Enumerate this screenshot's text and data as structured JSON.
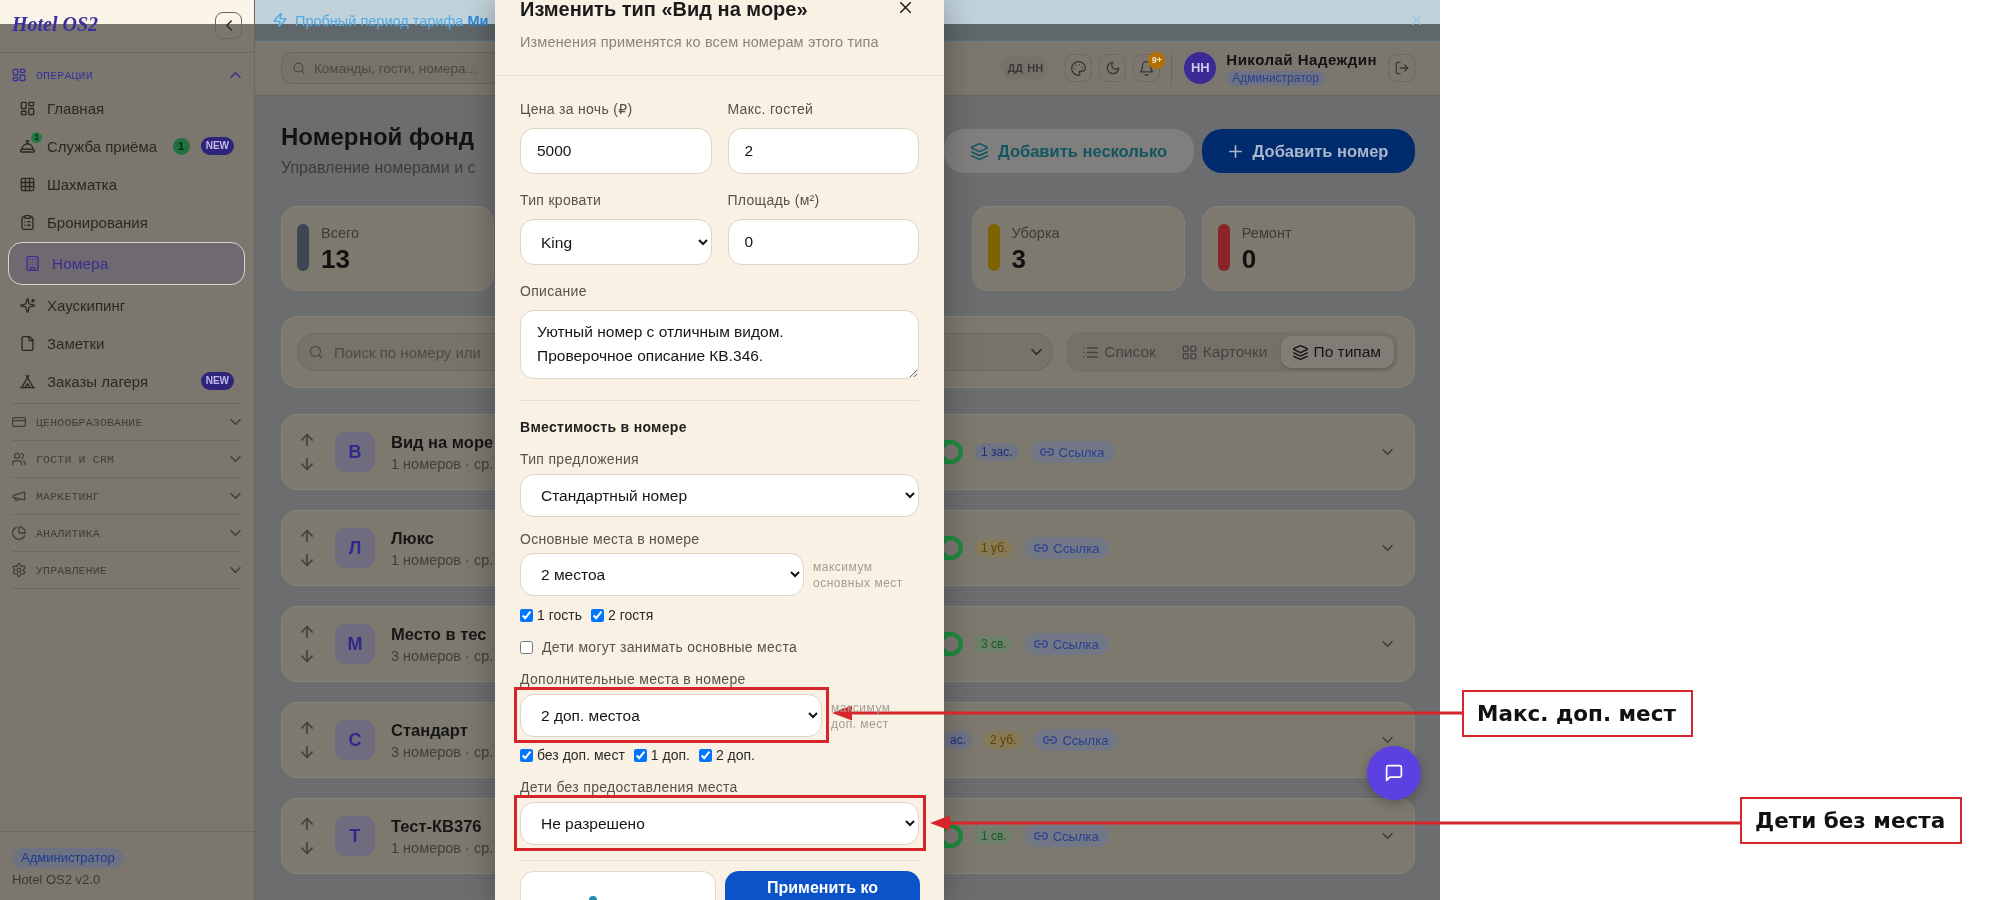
{
  "sidebar": {
    "logo": "Hotel OS2",
    "groups": [
      {
        "title": "ОПЕРАЦИИ",
        "expanded": true,
        "items": [
          {
            "label": "Главная",
            "selected": false
          },
          {
            "label": "Служба приёма",
            "selected": false,
            "icon_badge": "1",
            "count": "1",
            "tag": "NEW"
          },
          {
            "label": "Шахматка",
            "selected": false
          },
          {
            "label": "Бронирования",
            "selected": false
          },
          {
            "label": "Номера",
            "selected": true
          },
          {
            "label": "Хаускипинг",
            "selected": false
          },
          {
            "label": "Заметки",
            "selected": false
          },
          {
            "label": "Заказы лагеря",
            "selected": false,
            "tag": "NEW"
          }
        ]
      },
      {
        "title": "ЦЕНООБРАЗОВАНИЕ",
        "expanded": false
      },
      {
        "title": "ГОСТИ И CRM",
        "expanded": false
      },
      {
        "title": "МАРКЕТИНГ",
        "expanded": false
      },
      {
        "title": "АНАЛИТИКА",
        "expanded": false
      },
      {
        "title": "УПРАВЛЕНИЕ",
        "expanded": false
      }
    ],
    "role": "Администратор",
    "version": "Hotel OS2 v2.0"
  },
  "banner": {
    "text": "Пробный период тарифа **Ми**"
  },
  "topbar": {
    "search": {
      "placeholder": "Команды, гости, номера..."
    },
    "presence": [
      "ДД",
      "НН"
    ],
    "notifications": "9+",
    "user": {
      "initials": "НН",
      "name": "Николай Надеждин",
      "role": "Администратор"
    }
  },
  "page": {
    "title": "Номерной фонд",
    "subtitle": "Управление номерами и с",
    "actions": [
      {
        "label": "Добавить несколько",
        "kind": "secondary"
      },
      {
        "label": "Добавить номер",
        "kind": "primary"
      }
    ]
  },
  "stats": [
    {
      "label": "Всего",
      "value": "13",
      "color": "#3c4654"
    },
    {
      "label": "Уборка",
      "value": "3",
      "color": "#7d6300"
    },
    {
      "label": "Ремонт",
      "value": "0",
      "color": "#8a2428"
    }
  ],
  "filters": {
    "search": {
      "placeholder": "Поиск по номеру или"
    },
    "views": [
      {
        "label": "Список",
        "selected": false
      },
      {
        "label": "Карточки",
        "selected": false
      },
      {
        "label": "По типам",
        "selected": true
      }
    ]
  },
  "room_types": [
    {
      "letter": "В",
      "name": "Вид на море",
      "meta": "1 номеров · ср.",
      "active": true,
      "badges": [
        {
          "text": "1 зас.",
          "kind": "occupied"
        }
      ],
      "link": "Ссылка",
      "expanded": false
    },
    {
      "letter": "Л",
      "name": "Люкс",
      "meta": "1 номеров · ср.",
      "active": true,
      "badges": [
        {
          "text": "1 уб.",
          "kind": "cleaning"
        }
      ],
      "link": "Ссылка",
      "expanded": false
    },
    {
      "letter": "М",
      "name": "Место в тес",
      "meta": "3 номеров · ср.",
      "active": true,
      "badges": [
        {
          "text": "3 св.",
          "kind": "free"
        }
      ],
      "link": "Ссылка",
      "expanded": false
    },
    {
      "letter": "С",
      "name": "Стандарт",
      "meta": "3 номеров · ср.",
      "badges": [
        {
          "text": "ас.",
          "kind": "occupied"
        },
        {
          "text": "2 уб.",
          "kind": "cleaning"
        }
      ],
      "link": "Ссылка",
      "expanded": false
    },
    {
      "letter": "Т",
      "name": "Тест-КВ376",
      "meta": "1 номеров · ср.",
      "active": true,
      "badges": [
        {
          "text": "1 св.",
          "kind": "free"
        }
      ],
      "link": "Ссылка",
      "expanded": false
    }
  ],
  "modal": {
    "title": "Изменить тип «Вид на море»",
    "subtitle": "Изменения применятся ко всем номерам этого типа",
    "fields": [
      {
        "label": "Цена за ночь (₽)",
        "value": "5000",
        "kind": "input"
      },
      {
        "label": "Макс. гостей",
        "value": "2",
        "kind": "input"
      },
      {
        "label": "Тип кровати",
        "value": "King",
        "kind": "select"
      },
      {
        "label": "Площадь (м²)",
        "value": "0",
        "kind": "input"
      }
    ],
    "description": {
      "label": "Описание",
      "value": "Уютный номер с отличным видом.\nПроверочное описание КВ.346."
    },
    "capacity": {
      "title": "Вместимость в номере",
      "offer": {
        "label": "Тип предложения",
        "value": "Стандартный номер"
      },
      "main_places": {
        "label": "Основные места в номере",
        "value": "2 местоа",
        "hint": "максимум\nосновных мест",
        "options": [
          {
            "label": "1 гость",
            "checked": true
          },
          {
            "label": "2 гостя",
            "checked": true
          }
        ]
      },
      "children_main": {
        "label": "Дети могут занимать основные места",
        "checked": false
      },
      "extra_places": {
        "label": "Дополнительные места в номере",
        "value": "2 доп. местоа",
        "hint": "максимум\nдоп. мест",
        "options": [
          {
            "label": "без доп. мест",
            "checked": true
          },
          {
            "label": "1 доп.",
            "checked": true
          },
          {
            "label": "2 доп.",
            "checked": true
          }
        ],
        "annotation": "Макс. доп. мест"
      },
      "children_no_place": {
        "label": "Дети без предоставления места",
        "value": "Не разрешено",
        "annotation": "Дети без места"
      }
    },
    "buttons": [
      {
        "kind": "secondary"
      },
      {
        "kind": "primary",
        "label": "Применить ко"
      }
    ]
  }
}
